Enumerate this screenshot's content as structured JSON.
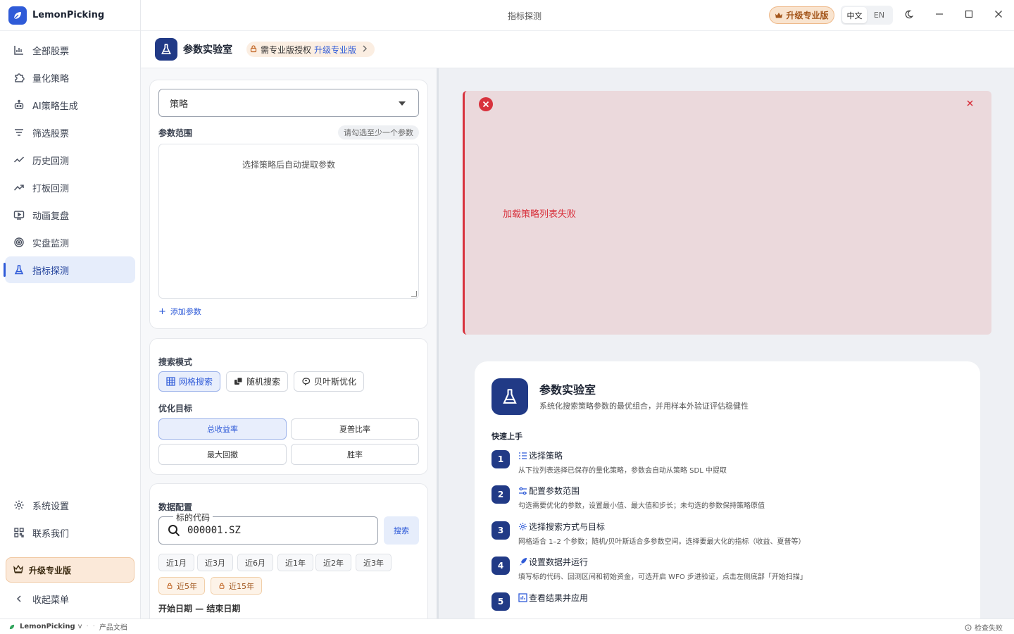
{
  "app": {
    "name": "LemonPicking",
    "window_title": "指标探测"
  },
  "topbar": {
    "upgrade_label": "升级专业版",
    "lang_zh": "中文",
    "lang_en": "EN"
  },
  "sidebar": {
    "items": [
      {
        "label": "全部股票",
        "icon": "bar-chart-icon"
      },
      {
        "label": "量化策略",
        "icon": "puzzle-icon"
      },
      {
        "label": "AI策略生成",
        "icon": "robot-icon"
      },
      {
        "label": "筛选股票",
        "icon": "filter-icon"
      },
      {
        "label": "历史回测",
        "icon": "trend-icon"
      },
      {
        "label": "打板回测",
        "icon": "trending-up-icon"
      },
      {
        "label": "动画复盘",
        "icon": "play-screen-icon"
      },
      {
        "label": "实盘监测",
        "icon": "radar-icon"
      },
      {
        "label": "指标探测",
        "icon": "flask-icon"
      }
    ],
    "settings": "系统设置",
    "contact": "联系我们",
    "upgrade": "升级专业版",
    "collapse": "收起菜单"
  },
  "page": {
    "title": "参数实验室",
    "auth_text": "需专业版授权",
    "auth_link": "升级专业版"
  },
  "config": {
    "strategy_placeholder": "策略",
    "param_range_label": "参数范围",
    "param_hint": "请勾选至少一个参数",
    "param_empty": "选择策略后自动提取参数",
    "add_param": "添加参数",
    "search_mode_label": "搜索模式",
    "modes": [
      "网格搜索",
      "随机搜索",
      "贝叶斯优化"
    ],
    "goal_label": "优化目标",
    "goals": [
      "总收益率",
      "夏普比率",
      "最大回撤",
      "胜率"
    ],
    "data_label": "数据配置",
    "code_legend": "标的代码",
    "code_value": "000001.SZ",
    "search_btn": "搜索",
    "ranges": [
      "近1月",
      "近3月",
      "近6月",
      "近1年",
      "近2年",
      "近3年"
    ],
    "locked_ranges": [
      "近5年",
      "近15年"
    ],
    "date_label": "开始日期 — 结束日期"
  },
  "alert": {
    "message": "加载策略列表失败"
  },
  "guide": {
    "title": "参数实验室",
    "subtitle": "系统化搜索策略参数的最优组合，并用样本外验证评估稳健性",
    "quick_start": "快速上手",
    "steps": [
      {
        "num": "1",
        "title": "选择策略",
        "desc": "从下拉列表选择已保存的量化策略，参数会自动从策略 SDL 中提取"
      },
      {
        "num": "2",
        "title": "配置参数范围",
        "desc": "勾选需要优化的参数，设置最小值、最大值和步长；未勾选的参数保持策略原值"
      },
      {
        "num": "3",
        "title": "选择搜索方式与目标",
        "desc": "网格适合 1–2 个参数；随机/贝叶斯适合多参数空间。选择要最大化的指标（收益、夏普等）"
      },
      {
        "num": "4",
        "title": "设置数据并运行",
        "desc": "填写标的代码、回测区间和初始资金，可选开启 WFO 步进验证，点击左侧底部「开始扫描」"
      },
      {
        "num": "5",
        "title": "查看结果并应用",
        "desc": ""
      }
    ]
  },
  "statusbar": {
    "app": "LemonPicking",
    "version": "v",
    "docs": "产品文档",
    "check": "检查失败"
  },
  "colors": {
    "primary": "#2f5bd8",
    "navy": "#213a86",
    "error": "#d8323d",
    "upgrade": "#a3551a"
  }
}
